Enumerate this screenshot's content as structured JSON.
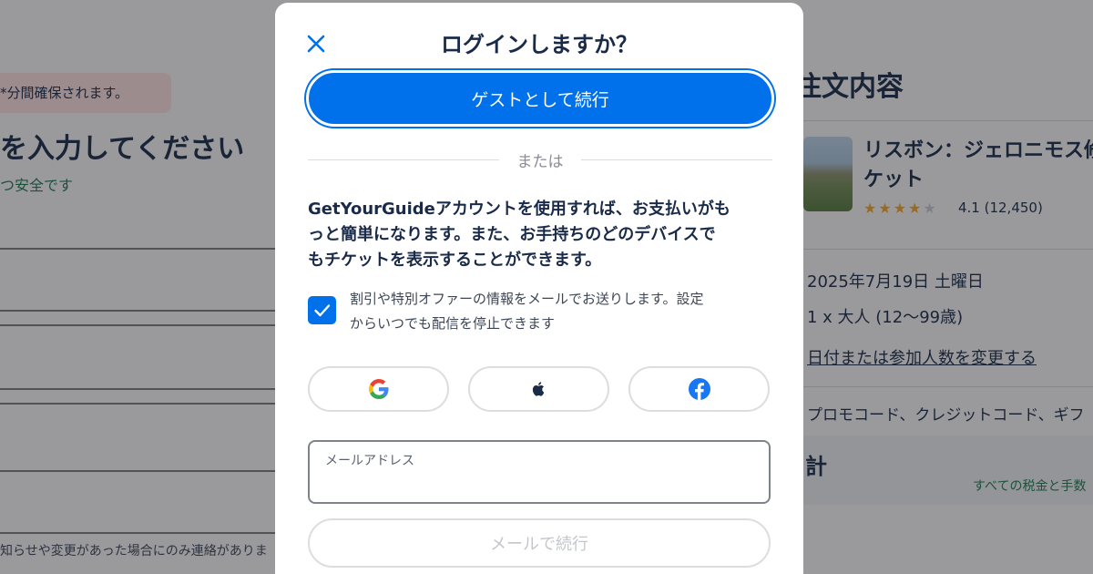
{
  "background": {
    "timer_banner": "*分間確保されます。",
    "heading": "を入力してください",
    "secure_note": "つ安全です",
    "contact_note": "知らせや変更があった場合にのみ連絡がありま",
    "order": {
      "title": "注文内容",
      "tour_title": "リスボン：ジェロニモス修道院チケット",
      "tour_title_visible": "リスボン：ジェロニモス修",
      "tour_title_line2": "ケット",
      "rating": "4.1 (12,450)",
      "rating_value": 4.1,
      "date": "2025年7月19日 土曜日",
      "participants": "1 x 大人 (12〜99歳)",
      "change_link": "日付または参加人数を変更する",
      "promo": "プロモコード、クレジットコード、ギフ",
      "total_label": "計",
      "tax_note": "すべての税金と手数"
    }
  },
  "modal": {
    "close_icon": "close-icon",
    "title": "ログインしますか？",
    "guest_button": "ゲストとして続行",
    "divider_text": "または",
    "description": "GetYourGuideアカウントを使用すれば、お支払いがもっと簡単になります。また、お手持ちのどのデバイスでもチケットを表示することができます。",
    "description_lines": [
      "GetYourGuideアカウントを使用すれば、お支払いがも",
      "っと簡単になります。また、お手持ちのどのデバイスで",
      "もチケットを表示することができます。"
    ],
    "newsletter": {
      "checked": true,
      "text": "割引や特別オファーの情報をメールでお送りします。設定からいつでも配信を停止できます",
      "lines": [
        "割引や特別オファーの情報をメールでお送りします。設定",
        "からいつでも配信を停止できます"
      ]
    },
    "social_buttons": [
      {
        "name": "google",
        "icon": "google-icon"
      },
      {
        "name": "apple",
        "icon": "apple-icon"
      },
      {
        "name": "facebook",
        "icon": "facebook-icon"
      }
    ],
    "email": {
      "label": "メールアドレス",
      "value": "",
      "continue_button": "メールで続行"
    }
  },
  "colors": {
    "primary": "#0071eb",
    "text": "#1a2b49",
    "secure_green": "#1e7b4e",
    "timer_bg": "#fcdede",
    "star": "#f5a623"
  }
}
